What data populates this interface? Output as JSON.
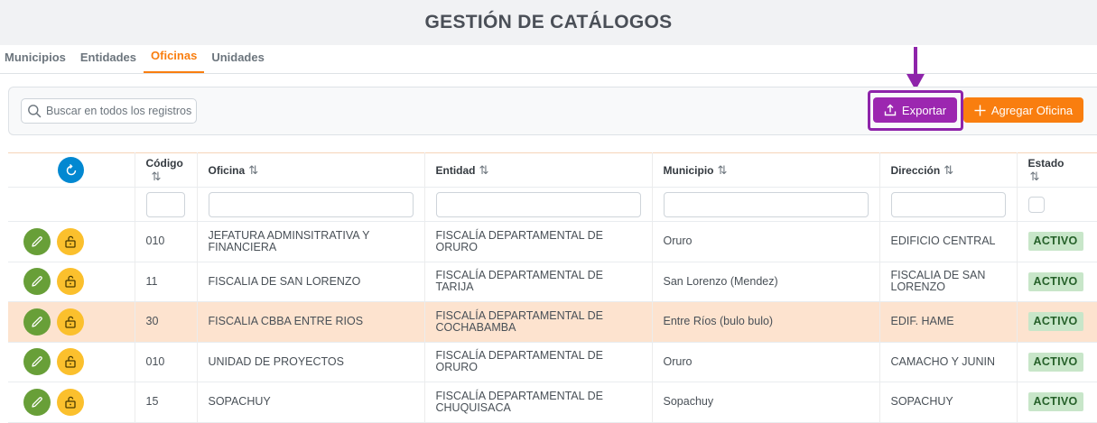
{
  "page": {
    "title": "GESTIÓN DE CATÁLOGOS"
  },
  "tabs": [
    {
      "label": "Municipios"
    },
    {
      "label": "Entidades"
    },
    {
      "label": "Oficinas",
      "active": true
    },
    {
      "label": "Unidades"
    }
  ],
  "toolbar": {
    "search_placeholder": "Buscar en todos los registros",
    "export_label": "Exportar",
    "add_label": "Agregar Oficina"
  },
  "colors": {
    "accent": "#f97e0f",
    "export": "#9c27b0",
    "highlight_frame": "#8e24aa",
    "edit": "#689f38",
    "lock": "#fbc02d",
    "refresh": "#0288d1",
    "status_bg": "#c8e6c9",
    "status_fg": "#256029"
  },
  "icons": {
    "search": "search-icon",
    "export": "upload-icon",
    "add": "plus-icon",
    "refresh": "refresh-icon",
    "edit": "pencil-icon",
    "lock": "unlock-icon",
    "sort": "sort-icon",
    "annotation": "arrow-down-icon"
  },
  "table": {
    "columns": {
      "codigo": "Código",
      "oficina": "Oficina",
      "entidad": "Entidad",
      "municipio": "Municipio",
      "direccion": "Dirección",
      "estado": "Estado"
    },
    "sort_glyph": "⇅",
    "rows": [
      {
        "codigo": "010",
        "oficina": "JEFATURA ADMINSITRATIVA Y FINANCIERA",
        "entidad": "FISCALÍA DEPARTAMENTAL DE ORURO",
        "municipio": "Oruro",
        "direccion": "EDIFICIO CENTRAL",
        "estado": "ACTIVO"
      },
      {
        "codigo": "11",
        "oficina": "FISCALIA DE SAN LORENZO",
        "entidad": "FISCALÍA DEPARTAMENTAL DE TARIJA",
        "municipio": "San Lorenzo (Mendez)",
        "direccion": "FISCALIA DE SAN LORENZO",
        "estado": "ACTIVO"
      },
      {
        "codigo": "30",
        "oficina": "FISCALIA CBBA ENTRE RIOS",
        "entidad": "FISCALÍA DEPARTAMENTAL DE COCHABAMBA",
        "municipio": "Entre Ríos (bulo bulo)",
        "direccion": "EDIF. HAME",
        "estado": "ACTIVO"
      },
      {
        "codigo": "010",
        "oficina": "UNIDAD DE PROYECTOS",
        "entidad": "FISCALÍA DEPARTAMENTAL DE ORURO",
        "municipio": "Oruro",
        "direccion": "CAMACHO Y JUNIN",
        "estado": "ACTIVO"
      },
      {
        "codigo": "15",
        "oficina": "SOPACHUY",
        "entidad": "FISCALÍA DEPARTAMENTAL DE CHUQUISACA",
        "municipio": "Sopachuy",
        "direccion": "SOPACHUY",
        "estado": "ACTIVO"
      }
    ]
  }
}
